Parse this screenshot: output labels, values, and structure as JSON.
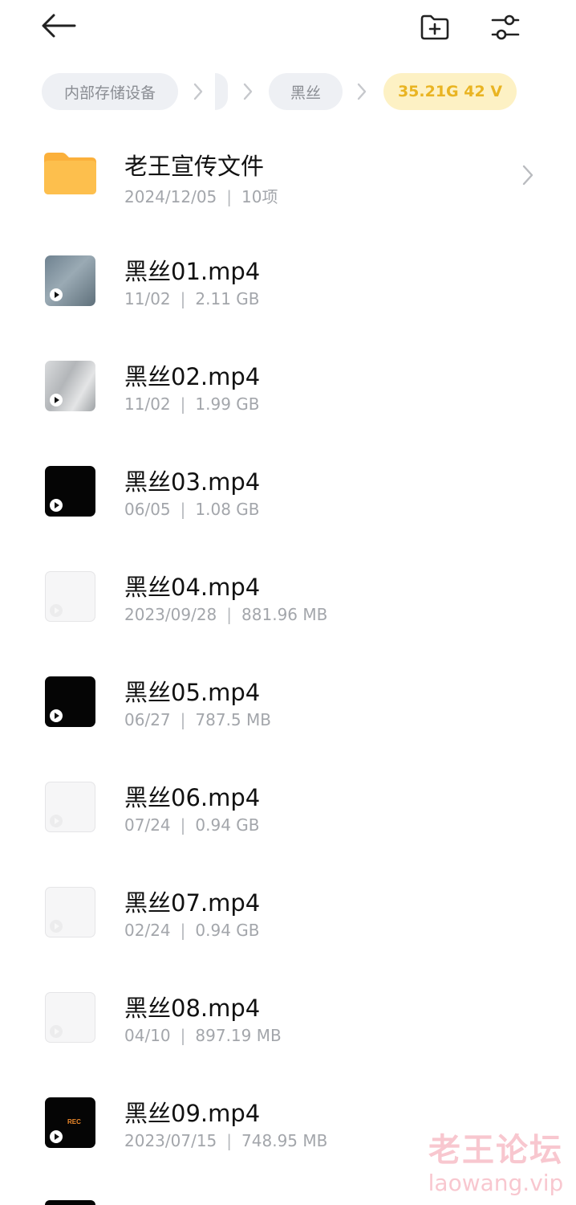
{
  "topbar": {
    "back_icon": "arrow-left-icon",
    "new_folder_icon": "folder-plus-icon",
    "filter_icon": "sliders-icon"
  },
  "breadcrumb": {
    "root": "内部存储设备",
    "folder": "黑丝",
    "current": "35.21G 42 V",
    "separator_icon": "chevron-right-icon"
  },
  "colors": {
    "folder": "#FBB03B",
    "breadcrumb_current_bg": "#FDF1C4",
    "breadcrumb_current_text": "#E9B422",
    "meta_text": "#A3A6AB",
    "watermark": "#F39AA9"
  },
  "files": [
    {
      "name": "老王宣传文件",
      "date": "2024/12/05",
      "info": "10项",
      "type": "folder"
    },
    {
      "name": "黑丝01.mp4",
      "date": "11/02",
      "info": "2.11 GB",
      "type": "video"
    },
    {
      "name": "黑丝02.mp4",
      "date": "11/02",
      "info": "1.99 GB",
      "type": "video"
    },
    {
      "name": "黑丝03.mp4",
      "date": "06/05",
      "info": "1.08 GB",
      "type": "video"
    },
    {
      "name": "黑丝04.mp4",
      "date": "2023/09/28",
      "info": "881.96 MB",
      "type": "video"
    },
    {
      "name": "黑丝05.mp4",
      "date": "06/27",
      "info": "787.5 MB",
      "type": "video"
    },
    {
      "name": "黑丝06.mp4",
      "date": "07/24",
      "info": "0.94 GB",
      "type": "video"
    },
    {
      "name": "黑丝07.mp4",
      "date": "02/24",
      "info": "0.94 GB",
      "type": "video"
    },
    {
      "name": "黑丝08.mp4",
      "date": "04/10",
      "info": "897.19 MB",
      "type": "video"
    },
    {
      "name": "黑丝09.mp4",
      "date": "2023/07/15",
      "info": "748.95 MB",
      "type": "video",
      "thumb_label": "REC"
    }
  ],
  "meta_separator": "|",
  "watermark": {
    "title": "老王论坛",
    "url": "laowang.vip"
  }
}
